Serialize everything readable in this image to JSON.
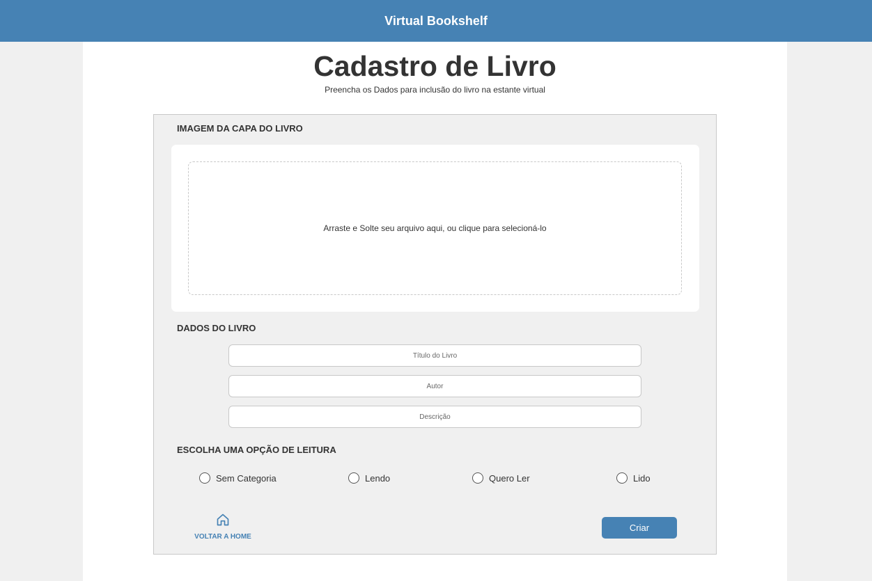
{
  "header": {
    "brand": "Virtual Bookshelf"
  },
  "page": {
    "title": "Cadastro de Livro",
    "subtitle": "Preencha os Dados para inclusão do livro na estante virtual"
  },
  "cover_section": {
    "label": "IMAGEM DA CAPA DO LIVRO",
    "dropzone_text": "Arraste e Solte seu arquivo aqui, ou clique para selecioná-lo"
  },
  "book_section": {
    "label": "DADOS DO LIVRO",
    "fields": [
      {
        "placeholder": "Título do Livro",
        "value": ""
      },
      {
        "placeholder": "Autor",
        "value": ""
      },
      {
        "placeholder": "Descrição",
        "value": ""
      }
    ]
  },
  "reading_section": {
    "label": "ESCOLHA UMA OPÇÃO DE LEITURA",
    "options": [
      {
        "label": "Sem Categoria",
        "selected": false
      },
      {
        "label": "Lendo",
        "selected": false
      },
      {
        "label": "Quero Ler",
        "selected": false
      },
      {
        "label": "Lido",
        "selected": false
      }
    ]
  },
  "actions": {
    "home_label": "VOLTAR A HOME",
    "home_icon": "home-icon",
    "create_label": "Criar"
  },
  "colors": {
    "primary": "#4682b4",
    "background": "#f0f0f0",
    "panel": "#ffffff",
    "text": "#333333"
  }
}
